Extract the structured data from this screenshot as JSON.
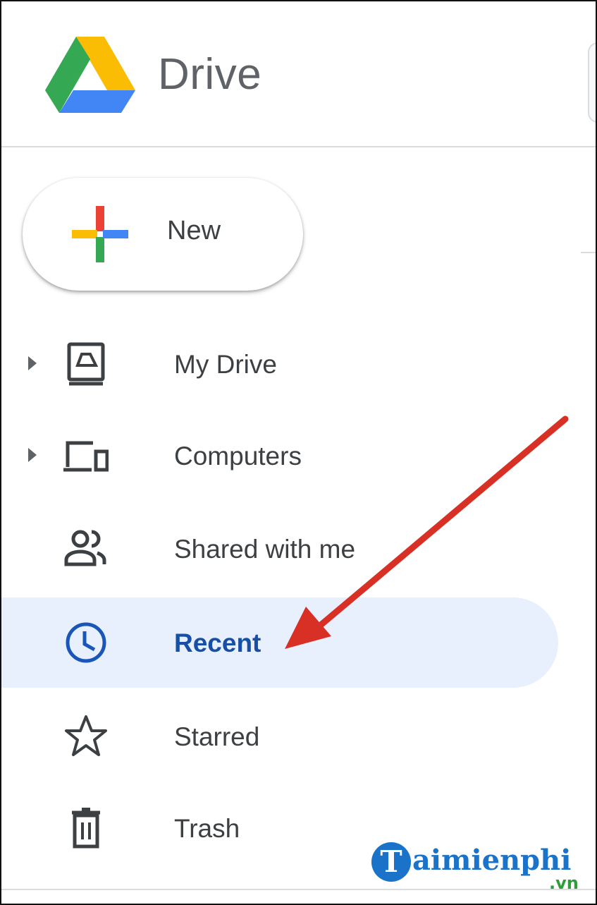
{
  "header": {
    "app_title": "Drive",
    "logo_icon": "google-drive-logo"
  },
  "new_button": {
    "label": "New",
    "icon": "colorful-plus-icon"
  },
  "sidebar": {
    "items": [
      {
        "label": "My Drive",
        "icon": "my-drive-icon",
        "expandable": true,
        "active": false
      },
      {
        "label": "Computers",
        "icon": "computers-icon",
        "expandable": true,
        "active": false
      },
      {
        "label": "Shared with me",
        "icon": "shared-with-me-icon",
        "expandable": false,
        "active": false
      },
      {
        "label": "Recent",
        "icon": "clock-icon",
        "expandable": false,
        "active": true
      },
      {
        "label": "Starred",
        "icon": "star-icon",
        "expandable": false,
        "active": false
      },
      {
        "label": "Trash",
        "icon": "trash-icon",
        "expandable": false,
        "active": false
      }
    ]
  },
  "annotation": {
    "type": "arrow",
    "color": "#d93025",
    "points_to": "Recent"
  },
  "watermark": {
    "text": "aimienphi",
    "initial": "T",
    "suffix": ".vn"
  },
  "colors": {
    "active_bg": "#e8f0fe",
    "active_text": "#174ea6",
    "icon_gray": "#5f6368",
    "text": "#3c4043",
    "arrow_red": "#d93025"
  }
}
